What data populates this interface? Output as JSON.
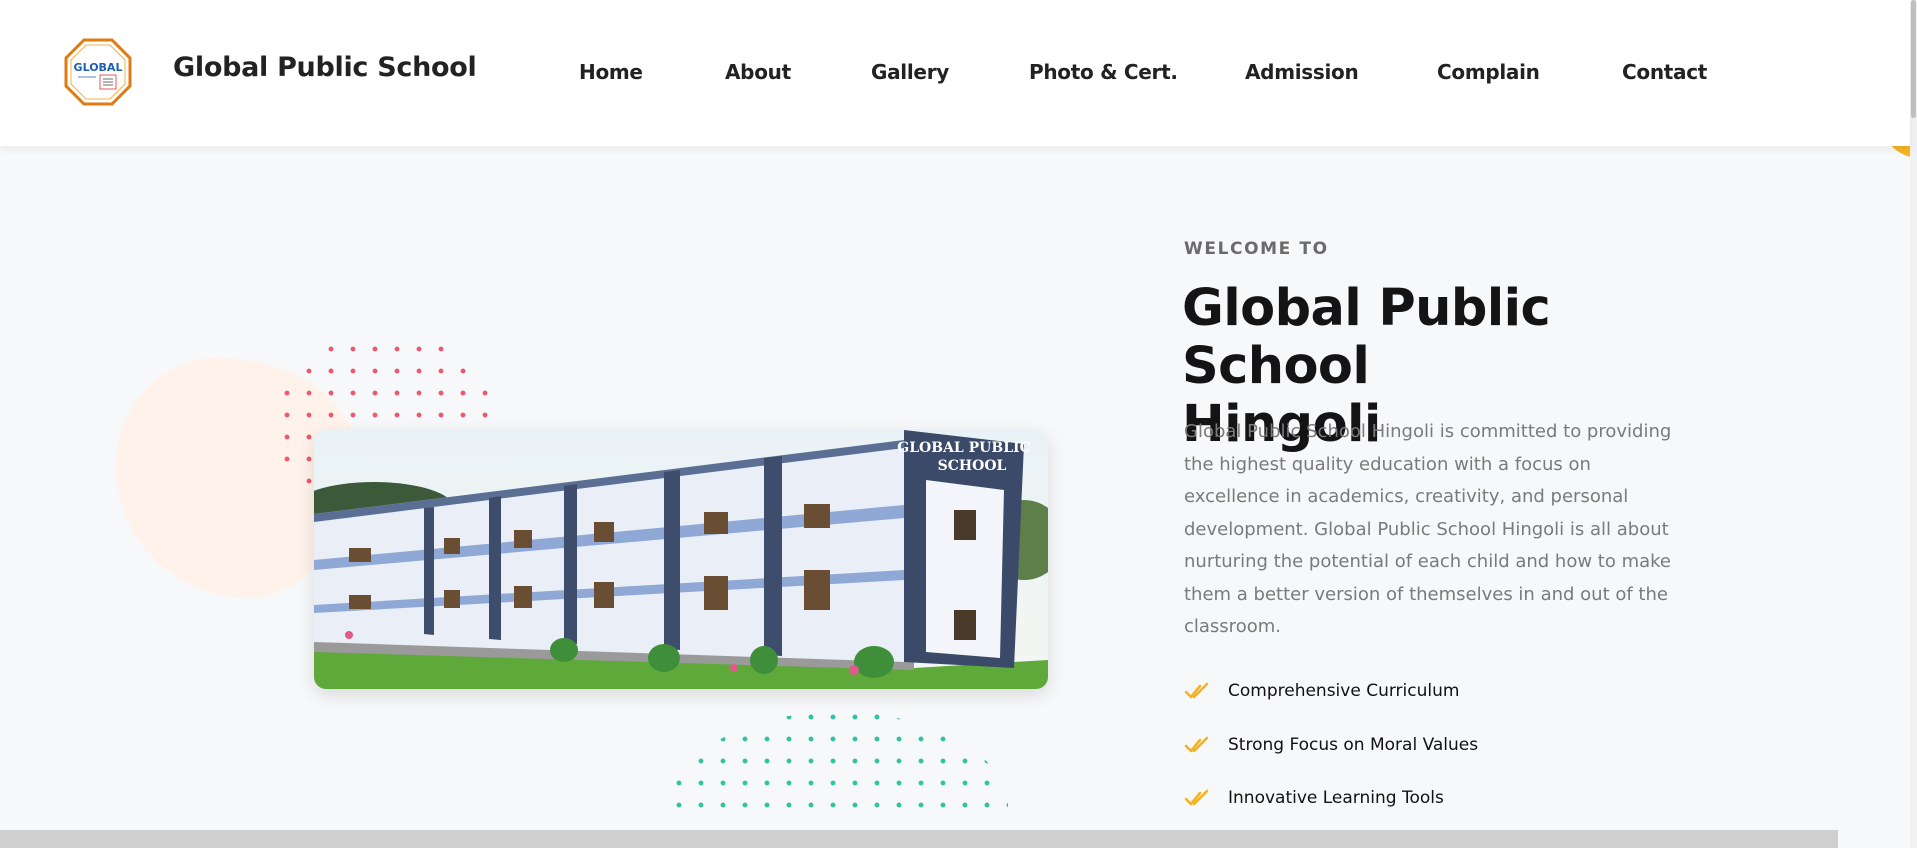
{
  "header": {
    "logo_text": "GLOBAL",
    "brand": "Global Public School",
    "nav": [
      "Home",
      "About",
      "Gallery",
      "Photo & Cert.",
      "Admission",
      "Complain",
      "Contact"
    ]
  },
  "hero": {
    "eyebrow": "WELCOME TO",
    "headline_line1": "Global Public School",
    "headline_line2": "Hingoli",
    "image_sign_line1": "GLOBAL PUBLIC",
    "image_sign_line2": "SCHOOL",
    "description": "Global Public School Hingoli  is committed to providing the highest quality education with a focus on excellence in academics, creativity, and personal development. Global Public School Hingoli is all about nurturing the potential of each child and how to make them a better version of themselves in and out of the classroom.",
    "features": [
      "Comprehensive Curriculum",
      "Strong Focus on Moral Values",
      "Innovative Learning Tools"
    ]
  },
  "colors": {
    "accent": "#f5b323",
    "dots_red": "#f0576a",
    "dots_green": "#2ec4a0",
    "logo_ring": "#e07b14"
  },
  "icons": {
    "logo": "school-logo-octagon",
    "feature": "double-check-icon"
  }
}
